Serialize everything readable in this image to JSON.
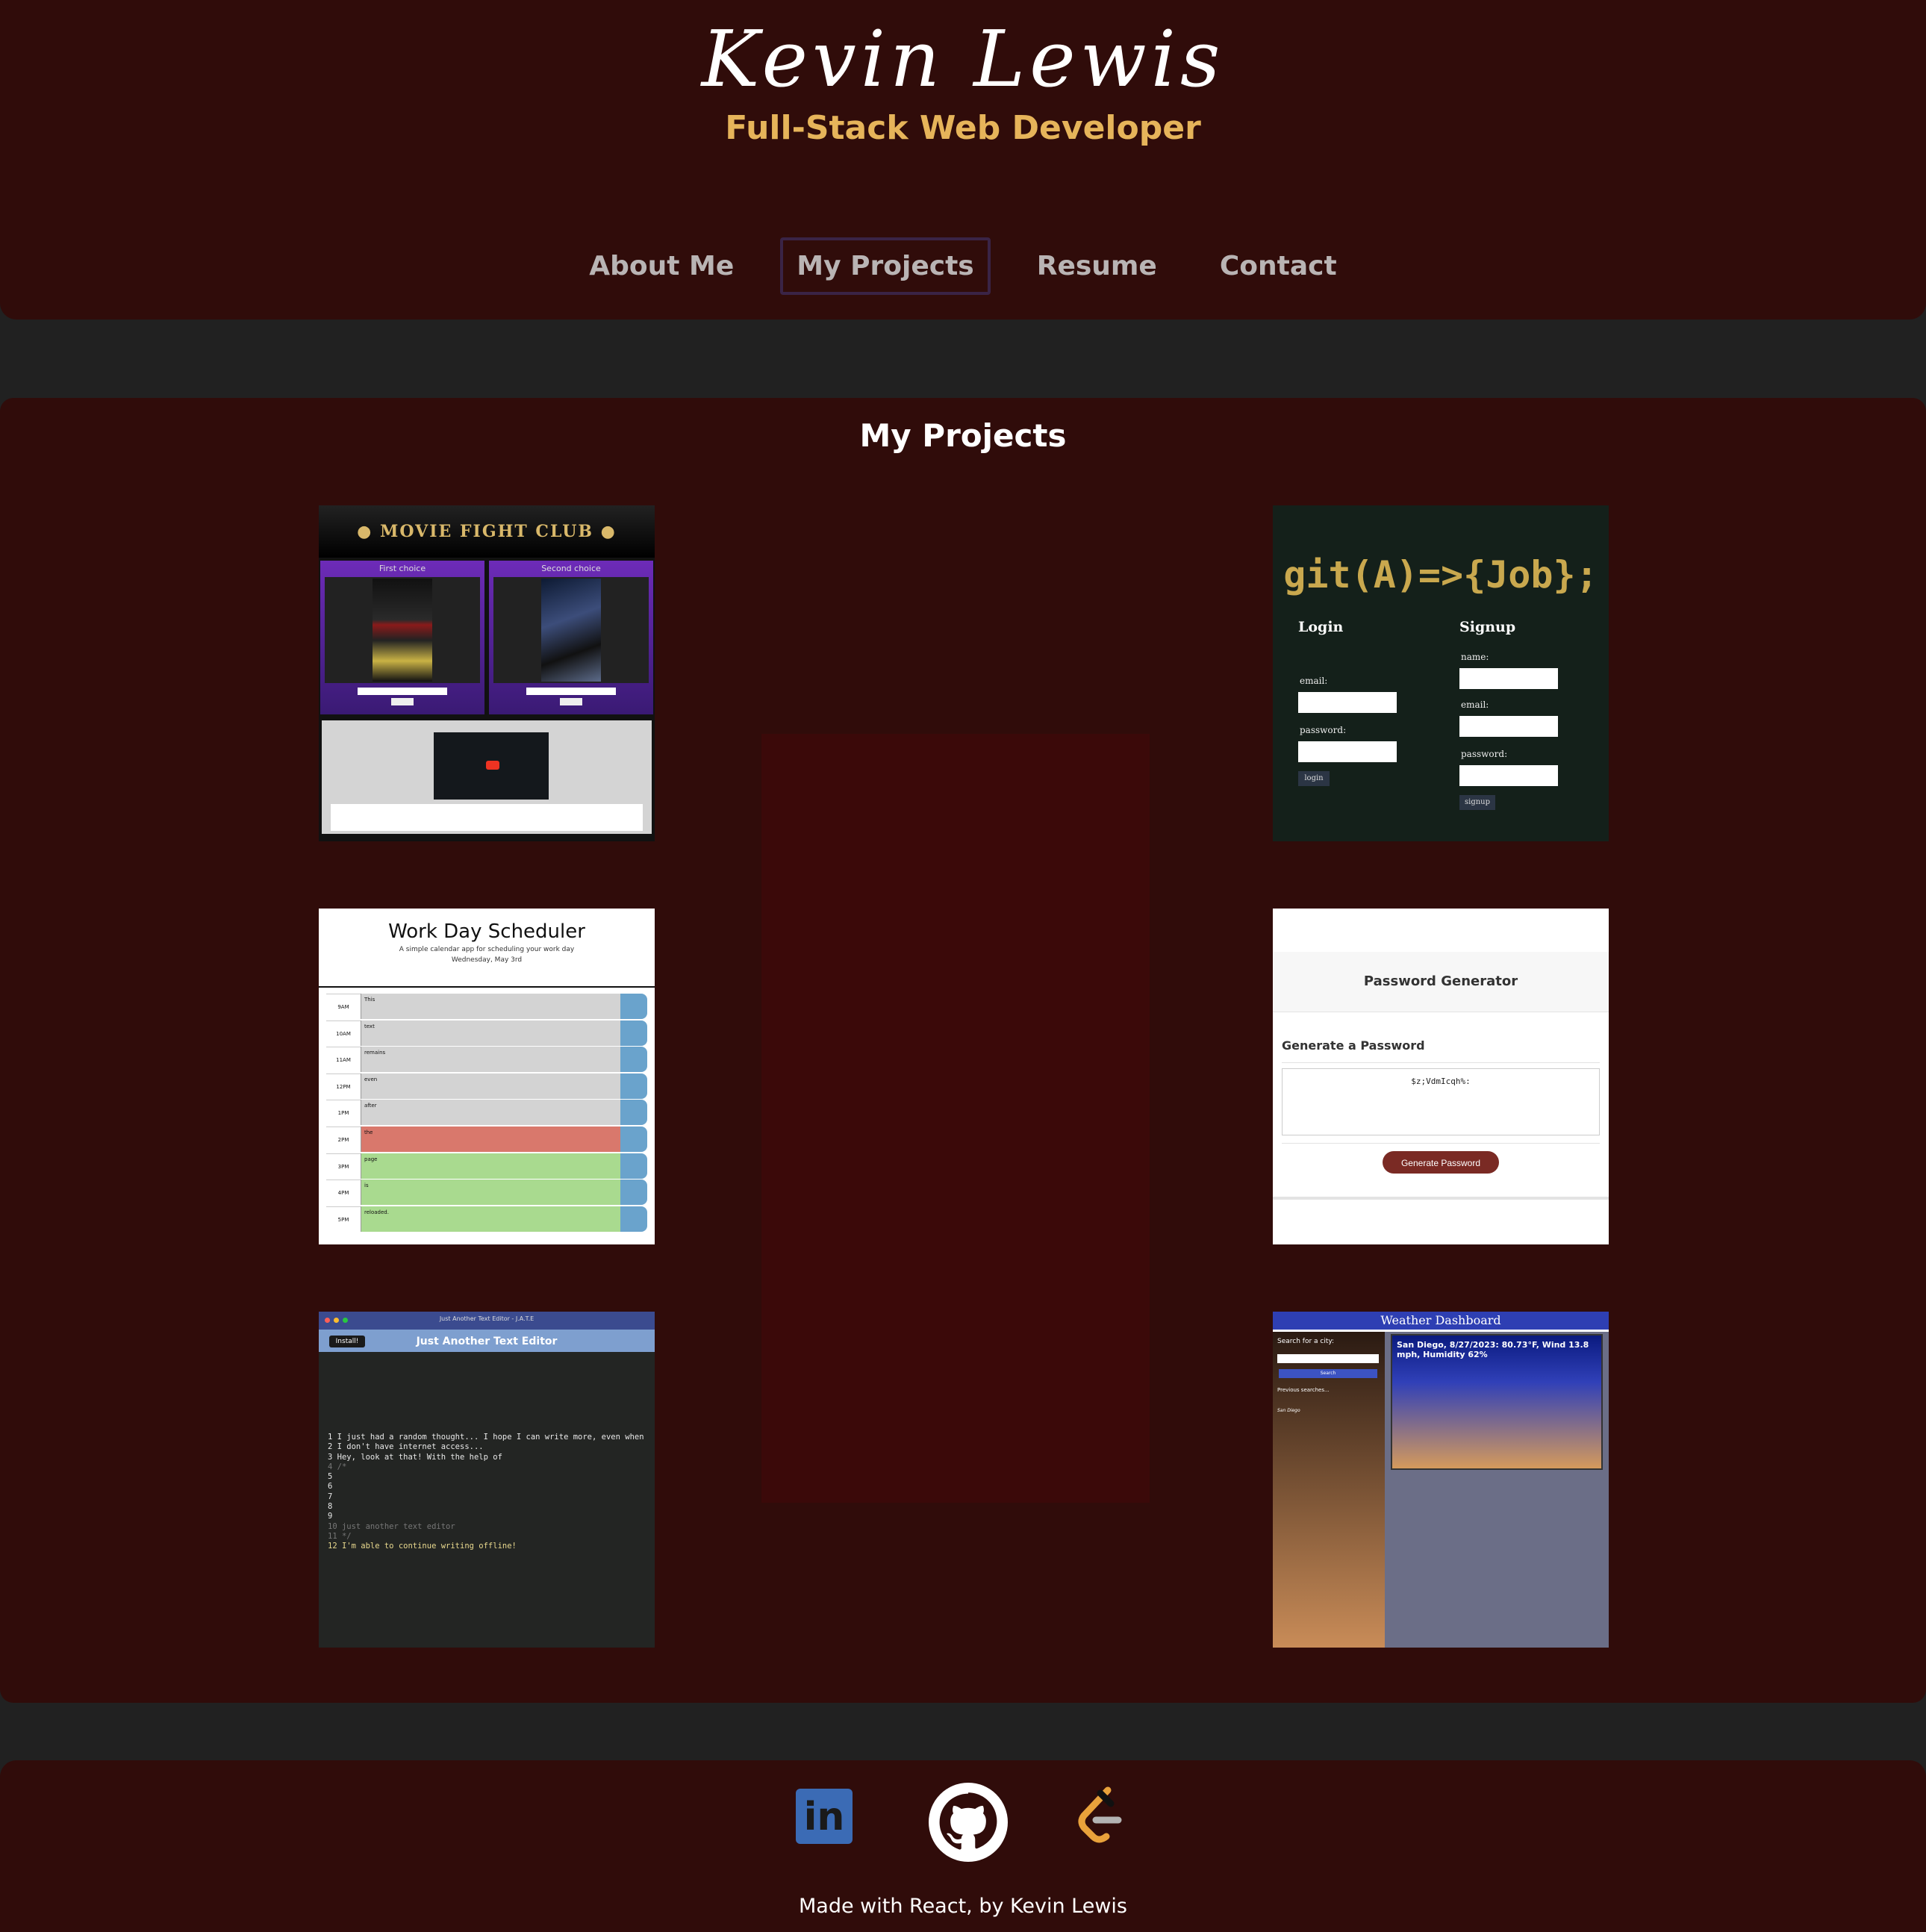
{
  "header": {
    "name": "Kevin Lewis",
    "role": "Full-Stack Web Developer",
    "nav": [
      {
        "label": "About Me"
      },
      {
        "label": "My Projects",
        "active": true
      },
      {
        "label": "Resume"
      },
      {
        "label": "Contact"
      }
    ]
  },
  "projects": {
    "title": "My Projects",
    "movie_fight_club": {
      "title": "MOVIE FIGHT CLUB",
      "first": "First choice",
      "second": "Second choice"
    },
    "git_job": {
      "title": "git(A)=>{Job};",
      "login": "Login",
      "signup": "Signup",
      "name_label": "name:",
      "email_label": "email:",
      "password_label": "password:",
      "login_button": "login",
      "signup_button": "signup"
    },
    "scheduler": {
      "title": "Work Day Scheduler",
      "subtitle": "A simple calendar app for scheduling your work day",
      "date": "Wednesday, May 3rd",
      "rows": [
        {
          "hour": "9AM",
          "text": "This",
          "state": "past"
        },
        {
          "hour": "10AM",
          "text": "text",
          "state": "past"
        },
        {
          "hour": "11AM",
          "text": "remains",
          "state": "past"
        },
        {
          "hour": "12PM",
          "text": "even",
          "state": "past"
        },
        {
          "hour": "1PM",
          "text": "after",
          "state": "past"
        },
        {
          "hour": "2PM",
          "text": "the",
          "state": "present"
        },
        {
          "hour": "3PM",
          "text": "page",
          "state": "future"
        },
        {
          "hour": "4PM",
          "text": "is",
          "state": "future"
        },
        {
          "hour": "5PM",
          "text": "reloaded.",
          "state": "future"
        }
      ]
    },
    "password": {
      "title": "Password Generator",
      "heading": "Generate a Password",
      "value": "$z;VdmIcqh%:",
      "button": "Generate Password"
    },
    "jate": {
      "window_title": "Just Another Text Editor - J.A.T.E",
      "install": "Install!",
      "title": "Just Another Text Editor",
      "lines": [
        "1 I just had a random thought... I hope I can write more, even when",
        "2 I don't have internet access...",
        "3 Hey, look at that! With the help of",
        "4 /*",
        "5",
        "6",
        "7",
        "8",
        "9",
        "10 just another text editor",
        "11 */",
        "12 I'm able to continue writing offline!"
      ]
    },
    "weather": {
      "title": "Weather Dashboard",
      "search_label": "Search for a city:",
      "search_button": "Search",
      "previous_label": "Previous searches...",
      "previous_item": "San Diego",
      "card": "San Diego, 8/27/2023: 80.73°F, Wind 13.8 mph, Humidity 62%"
    }
  },
  "footer": {
    "credit": "Made with React, by Kevin Lewis",
    "icons": [
      "linkedin-icon",
      "github-icon",
      "leetcode-icon"
    ]
  }
}
